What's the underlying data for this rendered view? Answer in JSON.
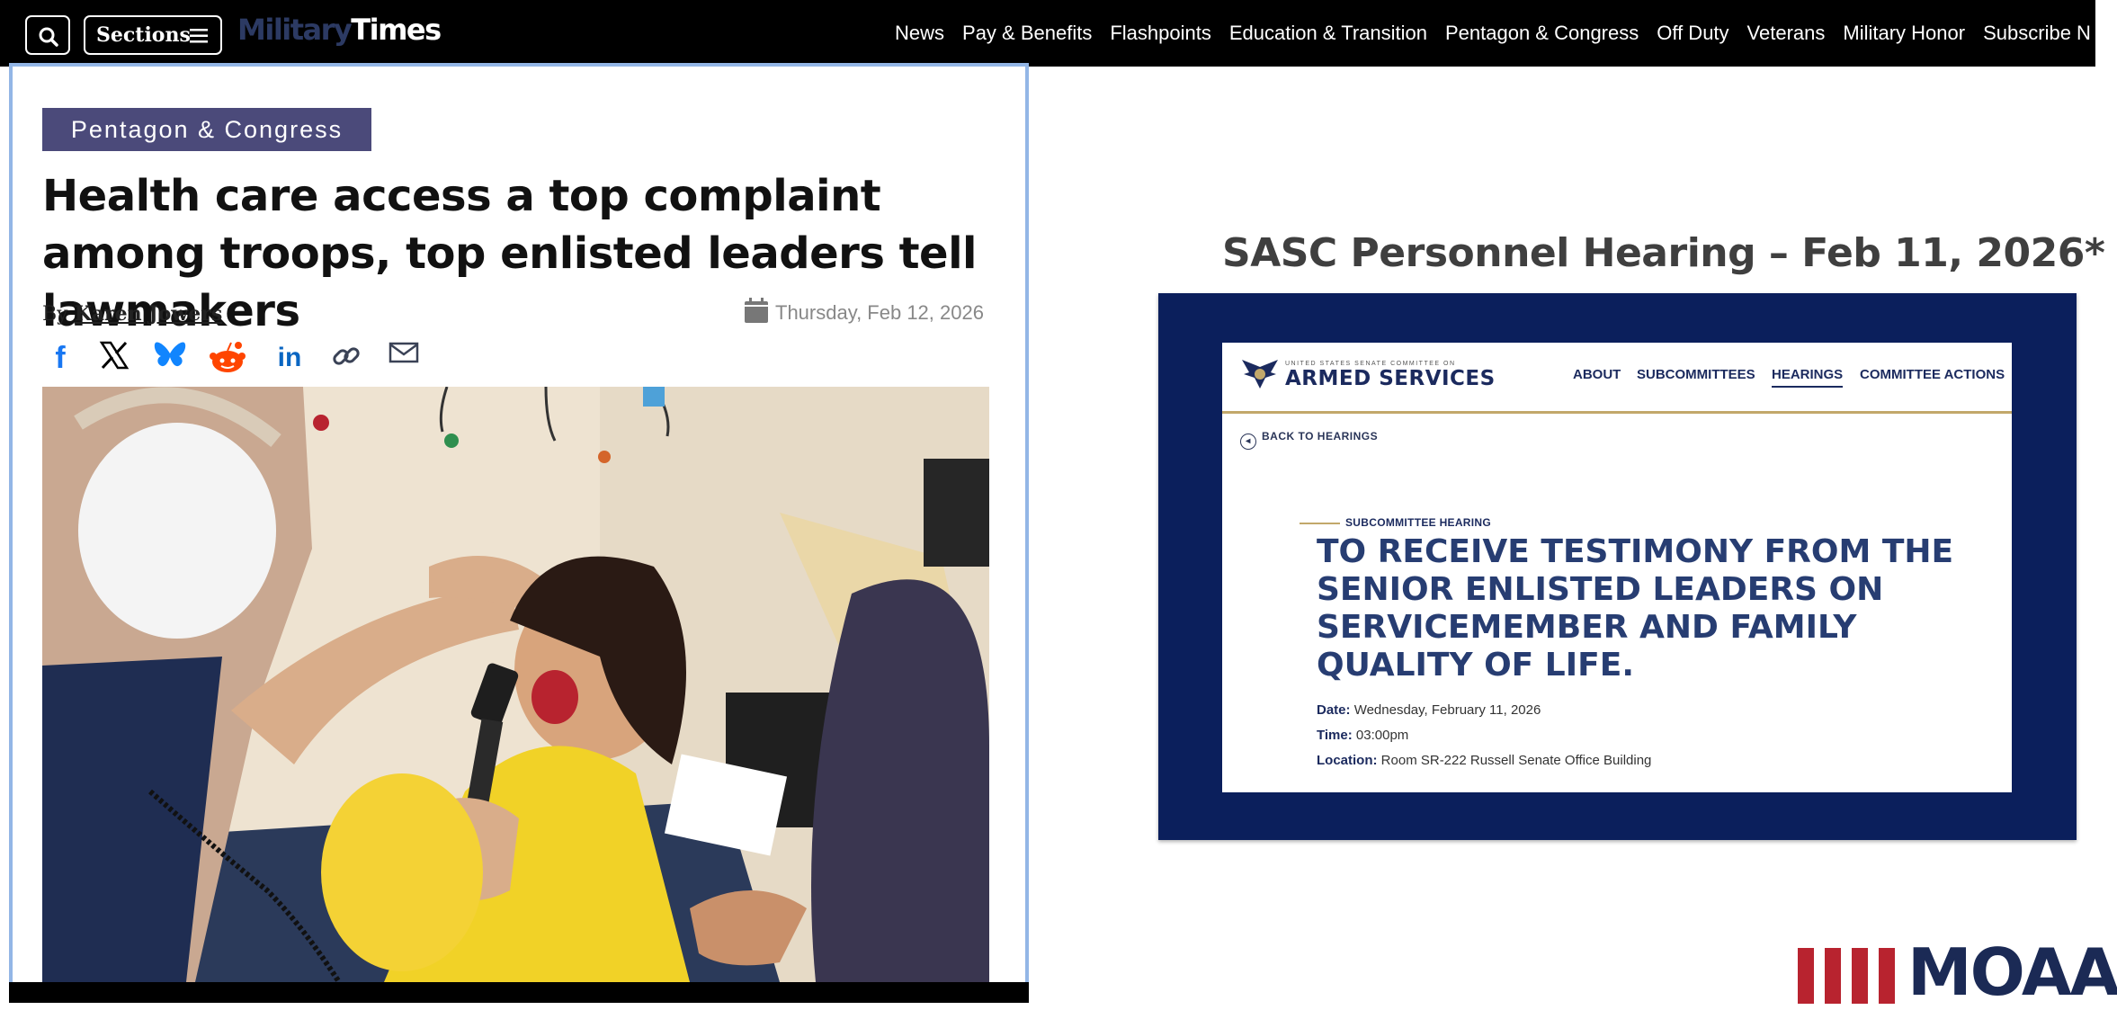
{
  "topnav": {
    "sections_label": "Sections",
    "brand_light": "Military",
    "brand_bold": "Times",
    "items": [
      "News",
      "Pay & Benefits",
      "Flashpoints",
      "Education & Transition",
      "Pentagon & Congress",
      "Off Duty",
      "Veterans",
      "Military Honor",
      "Subscribe N"
    ]
  },
  "article": {
    "category": "Pentagon & Congress",
    "headline": "Health care access a top complaint among troops, top enlisted leaders tell lawmakers",
    "by_prefix": "By",
    "author": "Karen Jowers",
    "date": "Thursday, Feb 12, 2026",
    "share_icons": [
      "facebook-icon",
      "x-icon",
      "bluesky-icon",
      "reddit-icon",
      "linkedin-icon",
      "link-icon",
      "email-icon"
    ]
  },
  "slide": {
    "title": "SASC Personnel Hearing – Feb 11, 2026*",
    "committee_small": "UNITED STATES SENATE COMMITTEE ON",
    "committee": "ARMED SERVICES",
    "nav": [
      "ABOUT",
      "SUBCOMMITTEES",
      "HEARINGS",
      "COMMITTEE ACTIONS"
    ],
    "back_label": "BACK TO HEARINGS",
    "kicker": "SUBCOMMITTEE HEARING",
    "hearing_title": "TO RECEIVE TESTIMONY FROM THE SENIOR ENLISTED LEADERS ON SERVICEMEMBER AND FAMILY QUALITY OF LIFE.",
    "date_label": "Date:",
    "date_value": "Wednesday, February 11, 2026",
    "time_label": "Time:",
    "time_value": "03:00pm",
    "location_label": "Location:",
    "location_value": "Room SR-222 Russell Senate Office Building"
  },
  "logo": {
    "text": "MOAA"
  },
  "colors": {
    "nav_bg": "#000000",
    "category_bg": "#4b4a7a",
    "frame_bg": "#0b1f5c",
    "sasc_navy": "#1b2a5e",
    "moaa_red": "#b8232f"
  }
}
